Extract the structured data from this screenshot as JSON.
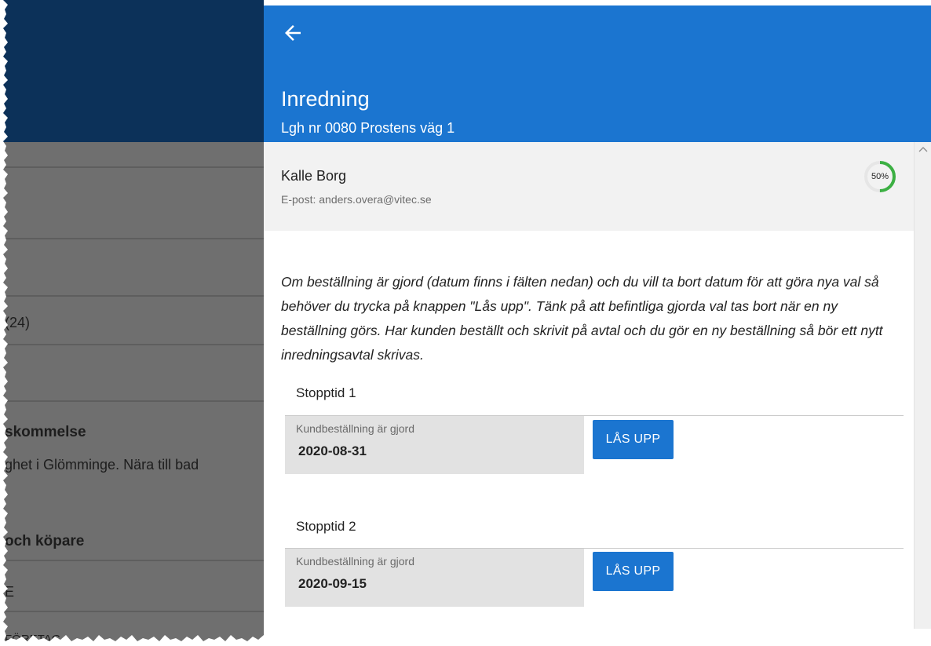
{
  "background": {
    "items": [
      {
        "text": "(24)"
      },
      {
        "text": "skommelse"
      },
      {
        "text": "ghet i Glömminge. Nära till bad"
      },
      {
        "text": "och köpare"
      },
      {
        "text": "E"
      },
      {
        "text": "FÖRETAG"
      }
    ]
  },
  "panel": {
    "back_icon": "arrow-left-icon",
    "title": "Inredning",
    "subtitle": "Lgh nr 0080 Prostens väg 1"
  },
  "customer": {
    "name": "Kalle Borg",
    "email": "E-post: anders.overa@vitec.se",
    "progress_label": "50%",
    "progress_fraction": 0.5
  },
  "info_text": "Om beställning är gjord (datum finns i fälten nedan) och du vill ta bort datum för att göra nya val så behöver du trycka på knappen \"Lås upp\". Tänk på att befintliga gjorda val tas bort när en ny beställning görs. Har kunden beställt och skrivit på avtal och du gör en ny beställning så bör ett nytt inredningsavtal skrivas.",
  "stops": [
    {
      "label": "Stopptid 1",
      "field_label": "Kundbeställning är gjord",
      "value": "2020-08-31",
      "button": "LÅS UPP"
    },
    {
      "label": "Stopptid 2",
      "field_label": "Kundbeställning är gjord",
      "value": "2020-09-15",
      "button": "LÅS UPP"
    }
  ],
  "colors": {
    "header": "#1b75d0",
    "background_header": "#0c3159",
    "background_overlay": "#6f6f6f",
    "progress": "#3cb043"
  }
}
